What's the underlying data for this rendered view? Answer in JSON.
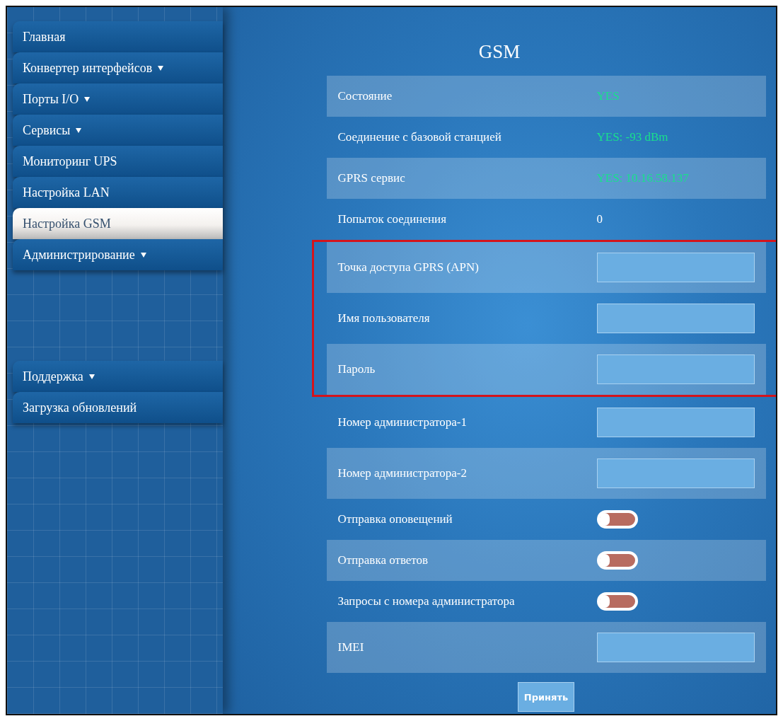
{
  "sidebar": {
    "top_items": [
      {
        "label": "Главная",
        "has_submenu": false,
        "selected": false
      },
      {
        "label": "Конвертер интерфейсов",
        "has_submenu": true,
        "selected": false
      },
      {
        "label": "Порты I/O",
        "has_submenu": true,
        "selected": false
      },
      {
        "label": "Сервисы",
        "has_submenu": true,
        "selected": false
      },
      {
        "label": "Мониторинг UPS",
        "has_submenu": false,
        "selected": false
      },
      {
        "label": "Настройка LAN",
        "has_submenu": false,
        "selected": false
      },
      {
        "label": "Настройка GSM",
        "has_submenu": false,
        "selected": true
      },
      {
        "label": "Администрирование",
        "has_submenu": true,
        "selected": false
      }
    ],
    "bottom_items": [
      {
        "label": "Поддержка",
        "has_submenu": true,
        "selected": false
      },
      {
        "label": "Загрузка обновлений",
        "has_submenu": false,
        "selected": false
      }
    ]
  },
  "title": "GSM",
  "rows": [
    {
      "kind": "status",
      "label": "Состояние",
      "value": "YES",
      "highlighted": false
    },
    {
      "kind": "status",
      "label": "Соединение с базовой станцией",
      "value": "YES: -93 dBm",
      "highlighted": false
    },
    {
      "kind": "status",
      "label": "GPRS сервис",
      "value": "YES: 10.16.58.137",
      "highlighted": false
    },
    {
      "kind": "text",
      "label": "Попыток соединения",
      "value": "0",
      "highlighted": false
    },
    {
      "kind": "input",
      "label": "Точка доступа GPRS (APN)",
      "highlighted": true
    },
    {
      "kind": "input",
      "label": "Имя пользователя",
      "highlighted": true
    },
    {
      "kind": "input",
      "label": "Пароль",
      "highlighted": true
    },
    {
      "kind": "input",
      "label": "Номер администратора-1",
      "highlighted": false
    },
    {
      "kind": "input",
      "label": "Номер администратора-2",
      "highlighted": false
    },
    {
      "kind": "toggle",
      "label": "Отправка оповещений",
      "on": false,
      "highlighted": false
    },
    {
      "kind": "toggle",
      "label": "Отправка ответов",
      "on": false,
      "highlighted": false
    },
    {
      "kind": "toggle",
      "label": "Запросы с номера администратора",
      "on": false,
      "highlighted": false
    },
    {
      "kind": "input",
      "label": "IMEI",
      "highlighted": false
    }
  ],
  "submit": "Принять"
}
